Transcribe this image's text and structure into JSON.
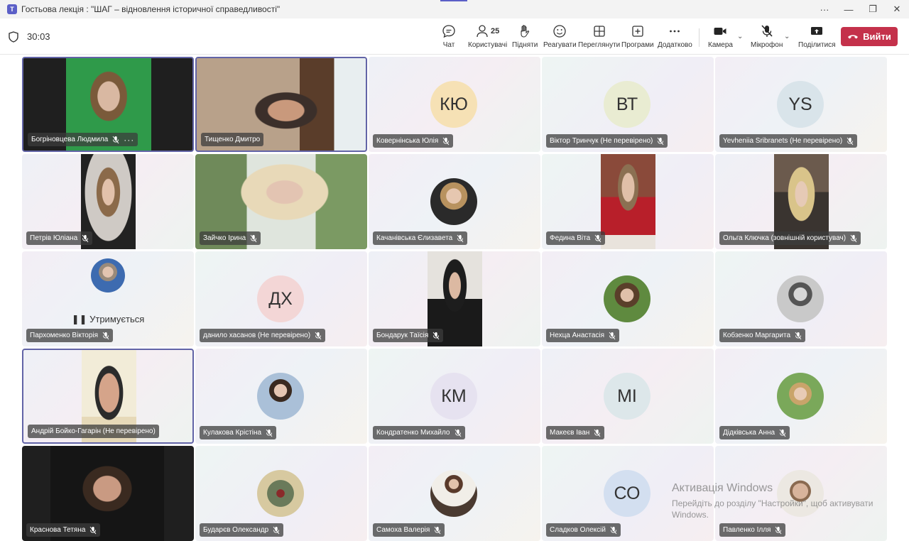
{
  "window": {
    "title": "Гостьова лекція : \"ШАГ – відновлення історичної справедливості\"",
    "minimize": "—",
    "restore": "❐",
    "close": "✕",
    "more": "···"
  },
  "meeting": {
    "timer": "30:03",
    "participants_count": "25"
  },
  "toolbar": {
    "chat": "Чат",
    "people": "Користувачі",
    "raise": "Підняти",
    "react": "Реагувати",
    "view": "Переглянути",
    "apps": "Програми",
    "more": "Додатково",
    "camera": "Камера",
    "mic": "Мікрофон",
    "share": "Поділитися",
    "leave": "Вийти"
  },
  "tiles": [
    {
      "name": "Богріновцева Людмила",
      "type": "video"
    },
    {
      "name": "Тищенко Дмитро",
      "type": "video"
    },
    {
      "name": "Ковернінська Юлія",
      "type": "initials",
      "initials": "КЮ",
      "color": "#f6e1b5"
    },
    {
      "name": "Віктор Тринчук (Не перевірено)",
      "type": "initials",
      "initials": "ВТ",
      "color": "#e9ecd2"
    },
    {
      "name": "Yevheniia Sribranets (Не перевірено)",
      "type": "initials",
      "initials": "YS",
      "color": "#d9e4ea"
    },
    {
      "name": "Петрів Юліана",
      "type": "video"
    },
    {
      "name": "Зайчко Ірина",
      "type": "video"
    },
    {
      "name": "Качанівська Єлизавета",
      "type": "photo"
    },
    {
      "name": "Федина Віта",
      "type": "video"
    },
    {
      "name": "Ольга Ключка (зовнішній користувач)",
      "type": "video"
    },
    {
      "name": "Пархоменко Вікторія",
      "type": "photo",
      "status": "Утримується"
    },
    {
      "name": "данило хасанов (Не перевірено)",
      "type": "initials",
      "initials": "ДХ",
      "color": "#f3d6d6"
    },
    {
      "name": "Бондарук Таїсія",
      "type": "video"
    },
    {
      "name": "Нехца Анастасія",
      "type": "photo"
    },
    {
      "name": "Кобзенко Маргарита",
      "type": "photo"
    },
    {
      "name": "Андрій Бойко-Гагарін (Не перевірено)",
      "type": "video"
    },
    {
      "name": "Кулакова Крістіна",
      "type": "photo"
    },
    {
      "name": "Кондратенко Михайло",
      "type": "initials",
      "initials": "КМ",
      "color": "#e6e2f0"
    },
    {
      "name": "Макеєв Іван",
      "type": "initials",
      "initials": "МІ",
      "color": "#dde7ea"
    },
    {
      "name": "Дідківська Анна",
      "type": "photo"
    },
    {
      "name": "Краснова Тетяна",
      "type": "video"
    },
    {
      "name": "Бударєв Олександр",
      "type": "photo"
    },
    {
      "name": "Самоха Валерія",
      "type": "photo"
    },
    {
      "name": "Сладков Олексій",
      "type": "initials",
      "initials": "СО",
      "color": "#d3dff0"
    },
    {
      "name": "Павленко Ілля",
      "type": "photo"
    }
  ],
  "watermark": {
    "title": "Активація Windows",
    "subtitle": "Перейдіть до розділу \"Настройки\", щоб активувати Windows."
  }
}
